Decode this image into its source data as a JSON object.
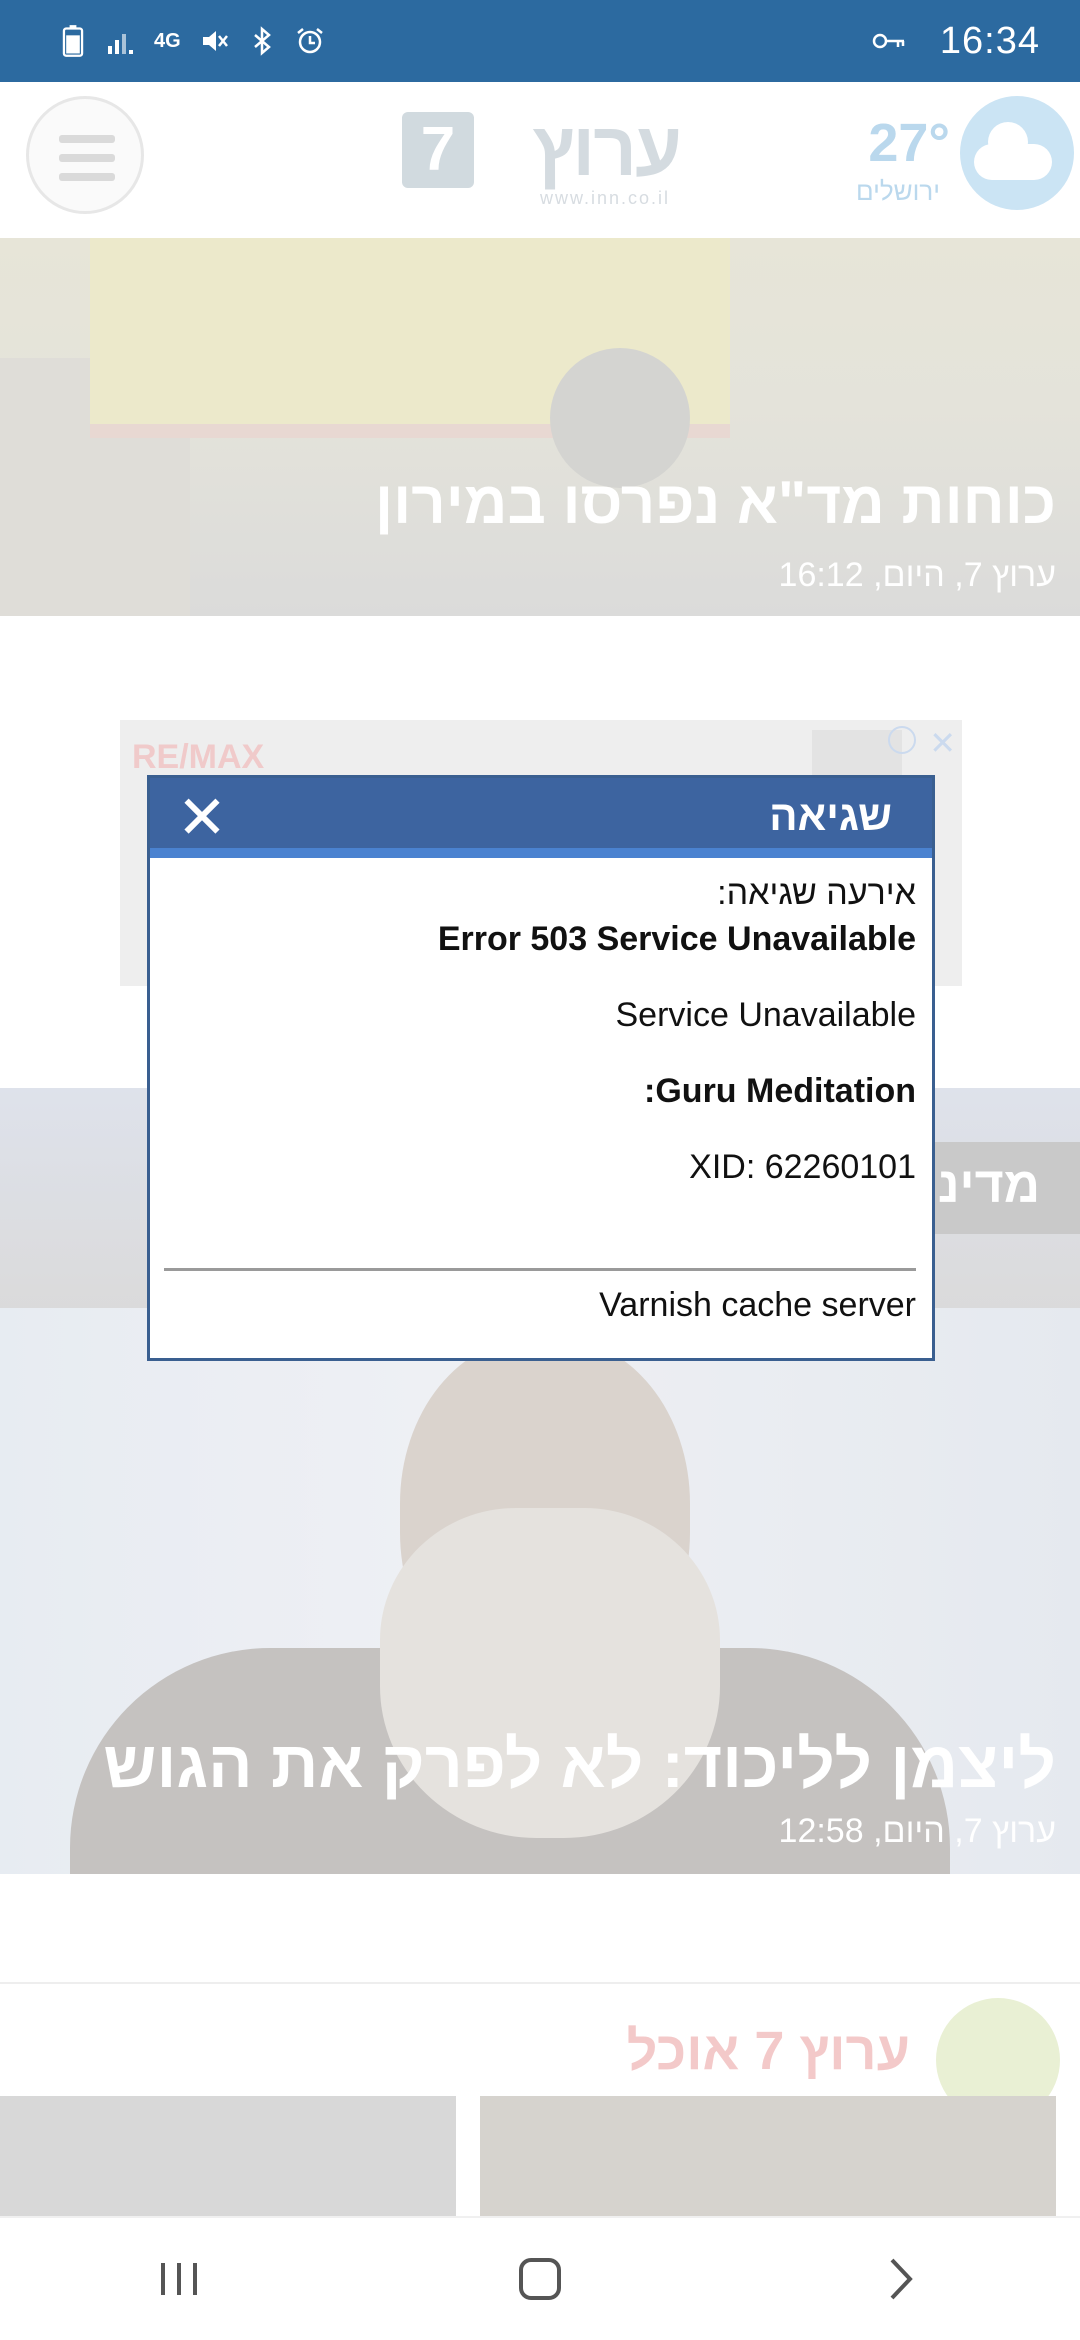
{
  "status_bar": {
    "time": "16:34",
    "network": "4G"
  },
  "header": {
    "logo_text": "ערוץ",
    "logo_number": "7",
    "logo_url": "www.inn.co.il",
    "weather_temp": "27°",
    "weather_city": "ירושלים"
  },
  "articles": [
    {
      "title": "כוחות מד\"א נפרסו במירון",
      "meta": "ערוץ 7, היום, 16:12"
    },
    {
      "category": "מדיני",
      "title": "ליצמן לליכוד: לא לפרק את הגוש",
      "meta": "ערוץ 7, היום, 12:58"
    }
  ],
  "ad": {
    "brand": "RE/MAX"
  },
  "food_section": {
    "title": "ערוץ 7 אוכל"
  },
  "dialog": {
    "title": "שגיאה",
    "intro": "אירעה שגיאה:",
    "error": "Error 503 Service Unavailable",
    "service": "Service Unavailable",
    "guru": ":Guru Meditation",
    "xid": "XID: 62260101",
    "server": "Varnish cache server"
  },
  "colors": {
    "status_bar": "#2c6aa0",
    "dialog_header": "#3d64a0",
    "dialog_accent": "#4a82d0"
  }
}
